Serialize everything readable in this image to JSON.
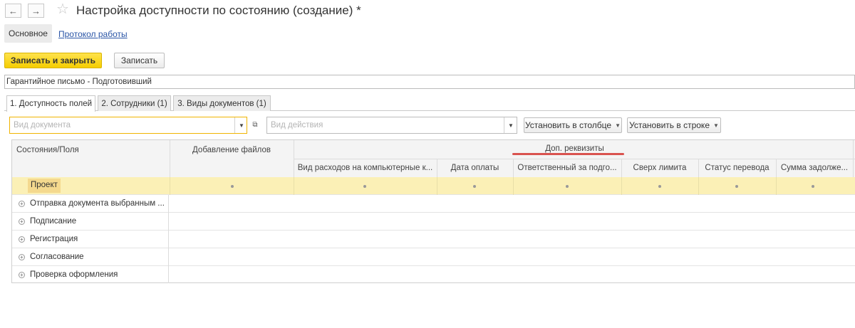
{
  "window": {
    "title": "Настройка доступности по состоянию (создание) *",
    "back_icon": "arrow-left-icon",
    "forward_icon": "arrow-right-icon",
    "favorite_icon": "star-icon"
  },
  "sections": {
    "main": "Основное",
    "log": "Протокол работы"
  },
  "toolbar": {
    "save_close": "Записать и закрыть",
    "save": "Записать"
  },
  "name_field": {
    "value": "Гарантийное письмо - Подготовивший"
  },
  "tabs": [
    {
      "label": "1. Доступность полей",
      "active": true
    },
    {
      "label": "2. Сотрудники (1)",
      "active": false
    },
    {
      "label": "3. Виды документов (1)",
      "active": false
    }
  ],
  "filters": {
    "doc_type_placeholder": "Вид документа",
    "action_type_placeholder": "Вид действия",
    "set_in_column": "Установить в столбце",
    "set_in_row": "Установить в строке"
  },
  "table": {
    "col_states": "Состояния/Поля",
    "col_add_files": "Добавление файлов",
    "group_extra": "Доп. реквизиты",
    "extra_columns": [
      "Вид расходов на компьютерные к...",
      "Дата оплаты",
      "Ответственный за подго...",
      "Сверх лимита",
      "Статус перевода",
      "Сумма задолже..."
    ],
    "rows": [
      {
        "label": "Проект",
        "selected": true,
        "expandable": false
      },
      {
        "label": "Отправка документа выбранным ...",
        "selected": false,
        "expandable": true
      },
      {
        "label": "Подписание",
        "selected": false,
        "expandable": true
      },
      {
        "label": "Регистрация",
        "selected": false,
        "expandable": true
      },
      {
        "label": "Согласование",
        "selected": false,
        "expandable": true
      },
      {
        "label": "Проверка оформления",
        "selected": false,
        "expandable": true
      }
    ]
  },
  "colors": {
    "primary_button": "#f5cd00",
    "selected_row": "#fbf0b6",
    "focus_border": "#f0b400",
    "link": "#2a55a6",
    "annotation_underline": "#d9534f"
  }
}
